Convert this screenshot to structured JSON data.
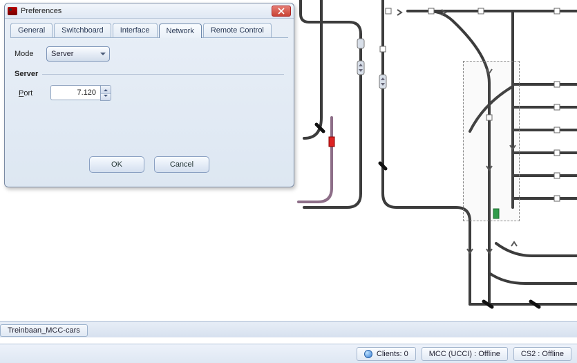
{
  "dialog": {
    "title": "Preferences",
    "tabs": [
      "General",
      "Switchboard",
      "Interface",
      "Network",
      "Remote Control"
    ],
    "active_tab_index": 3,
    "mode_label": "Mode",
    "mode_value": "Server",
    "server_legend": "Server",
    "port_label": "Port",
    "port_underline_char": "P",
    "port_value": "7.120",
    "ok_label": "OK",
    "cancel_label": "Cancel"
  },
  "doc_tab": "Treinbaan_MCC-cars",
  "status": {
    "clients_label": "Clients: 0",
    "mcc_label": "MCC (UCCI) :  Offline",
    "cs2_label": "CS2 :  Offline"
  },
  "colors": {
    "track_main": "#3c3c3c",
    "track_alt": "#8d6e88",
    "node": "#ffffff",
    "node_stroke": "#555",
    "marker_red": "#d22",
    "marker_green": "#2a9c46"
  }
}
